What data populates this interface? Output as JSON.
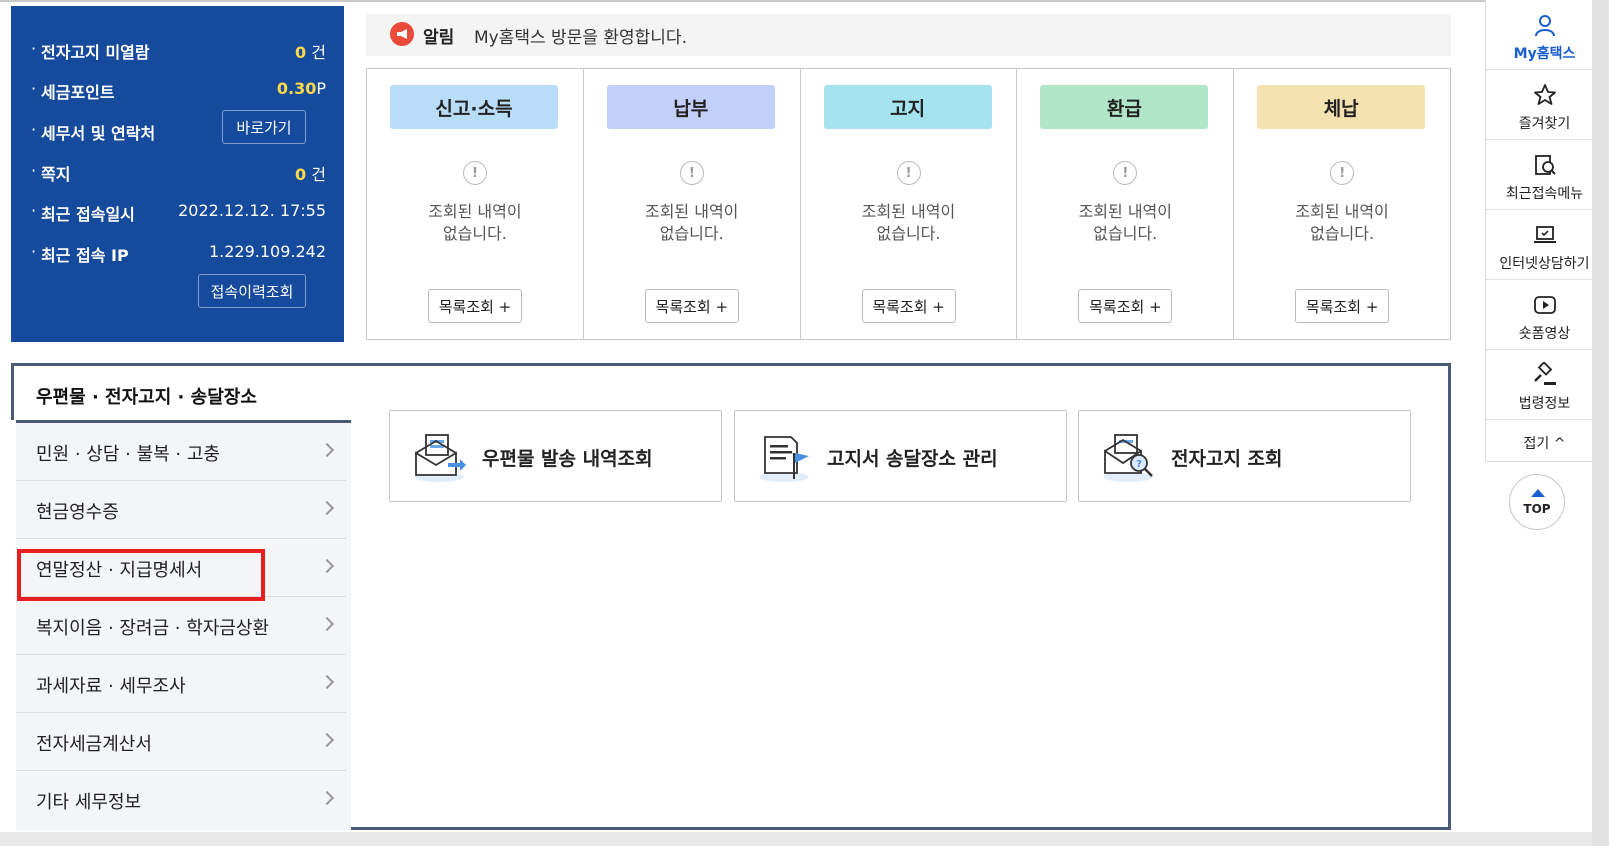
{
  "info_panel": {
    "rows": [
      {
        "label": "전자고지 미열람",
        "value_num": "0",
        "value_unit": "건"
      },
      {
        "label": "세금포인트",
        "value_num": "0.30",
        "value_unit": "P"
      },
      {
        "label": "세무서 및 연락처",
        "button": "바로가기"
      },
      {
        "label": "쪽지",
        "value_num": "0",
        "value_unit": "건"
      },
      {
        "label": "최근 접속일시",
        "value": "2022.12.12.  17:55"
      },
      {
        "label": "최근 접속 IP",
        "value": "1.229.109.242"
      }
    ],
    "history_button": "접속이력조회"
  },
  "notice": {
    "label": "알림",
    "text": "My홈택스 방문을 환영합니다."
  },
  "status_cards": [
    {
      "title": "신고·소득",
      "color": "#b9dcf7",
      "empty_line1": "조회된 내역이",
      "empty_line2": "없습니다.",
      "button": "목록조회 +"
    },
    {
      "title": "납부",
      "color": "#c2cff8",
      "empty_line1": "조회된 내역이",
      "empty_line2": "없습니다.",
      "button": "목록조회 +"
    },
    {
      "title": "고지",
      "color": "#a4e3ef",
      "empty_line1": "조회된 내역이",
      "empty_line2": "없습니다.",
      "button": "목록조회 +"
    },
    {
      "title": "환급",
      "color": "#b2e6c9",
      "empty_line1": "조회된 내역이",
      "empty_line2": "없습니다.",
      "button": "목록조회 +"
    },
    {
      "title": "체납",
      "color": "#f4e2b0",
      "empty_line1": "조회된 내역이",
      "empty_line2": "없습니다.",
      "button": "목록조회 +"
    }
  ],
  "section": {
    "title": "우편물 · 전자고지 · 송달장소",
    "menu": [
      "민원 · 상담 · 불복 · 고충",
      "현금영수증",
      "연말정산 · 지급명세서",
      "복지이음 · 장려금 · 학자금상환",
      "과세자료 · 세무조사",
      "전자세금계산서",
      "기타 세무정보"
    ],
    "cards": [
      {
        "label": "우편물 발송 내역조회",
        "icon": "mail-list-icon"
      },
      {
        "label": "고지서 송달장소 관리",
        "icon": "document-flag-icon"
      },
      {
        "label": "전자고지 조회",
        "icon": "mail-search-icon"
      }
    ]
  },
  "quickbar": {
    "items": [
      {
        "label": "My홈택스",
        "icon": "user-icon",
        "active": true
      },
      {
        "label": "즐겨찾기",
        "icon": "star-icon"
      },
      {
        "label": "최근접속메뉴",
        "icon": "recent-menu-icon"
      },
      {
        "label": "인터넷상담하기",
        "icon": "laptop-chat-icon"
      },
      {
        "label": "숏폼영상",
        "icon": "play-icon"
      },
      {
        "label": "법령정보",
        "icon": "gavel-icon"
      }
    ],
    "fold": "접기 ^",
    "top": "TOP"
  },
  "colors": {
    "panel_blue": "#164a9c",
    "accent_yellow": "#ffd84a",
    "active_blue": "#1a5fd0",
    "highlight_red": "#e61e1e",
    "section_border": "#4a5b72"
  }
}
